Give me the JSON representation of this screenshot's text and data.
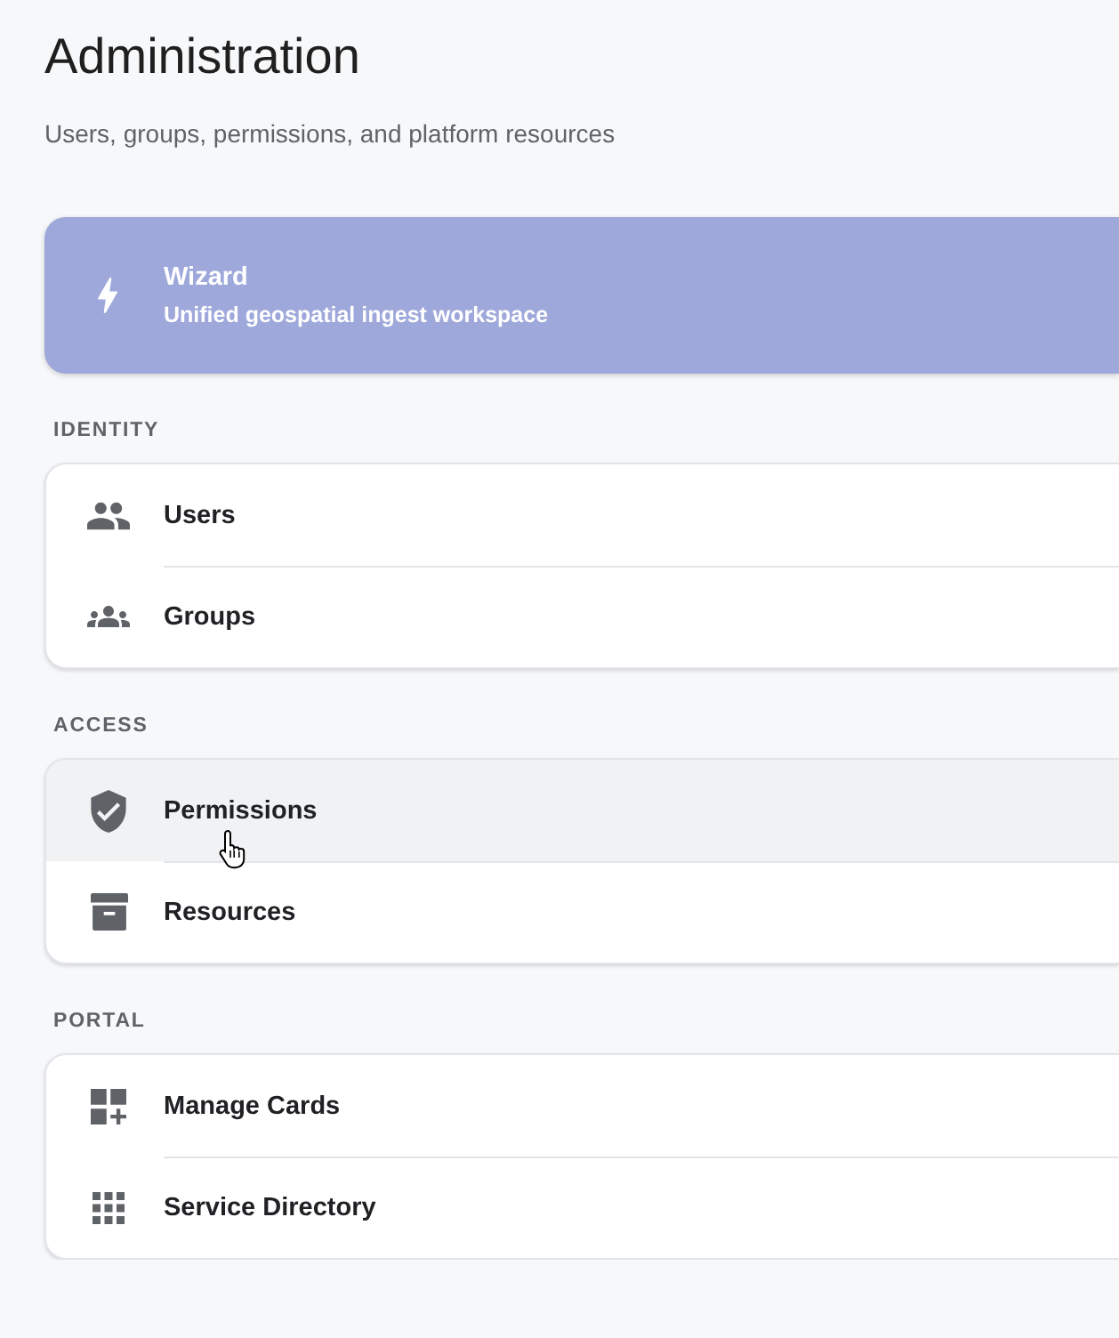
{
  "page": {
    "title": "Administration",
    "subtitle": "Users, groups, permissions, and platform resources"
  },
  "feature_card": {
    "kind": "bolt",
    "title": "Wizard",
    "description": "Unified geospatial ingest workspace"
  },
  "sections": [
    {
      "label": "IDENTITY",
      "items": [
        {
          "kind": "people",
          "label": "Users",
          "hovered": false
        },
        {
          "kind": "groups",
          "label": "Groups",
          "hovered": false
        }
      ]
    },
    {
      "label": "ACCESS",
      "items": [
        {
          "kind": "shield",
          "label": "Permissions",
          "hovered": true
        },
        {
          "kind": "archive",
          "label": "Resources",
          "hovered": false
        }
      ]
    },
    {
      "label": "PORTAL",
      "items": [
        {
          "kind": "dashboard",
          "label": "Manage Cards",
          "hovered": false
        },
        {
          "kind": "apps",
          "label": "Service Directory",
          "hovered": false
        }
      ]
    }
  ]
}
